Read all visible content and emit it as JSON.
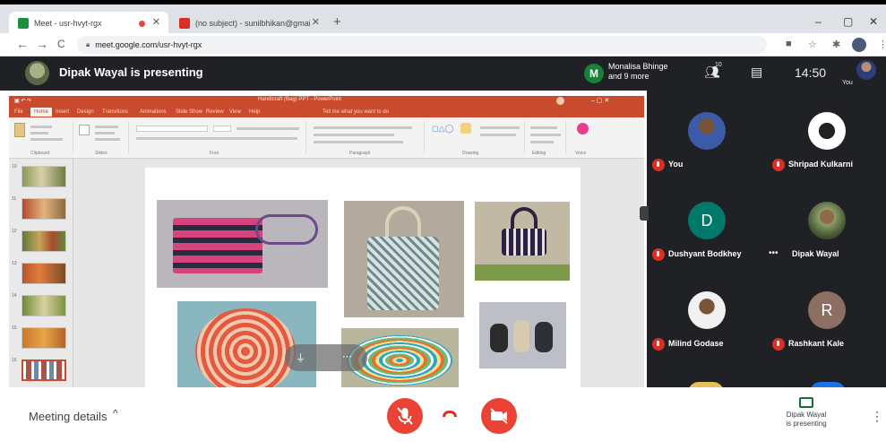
{
  "browser": {
    "tabs": [
      {
        "title": "Meet - usr-hvyt-rgx",
        "favicon_color": "#1e8e3e",
        "recording": true
      },
      {
        "title": "(no subject) - sunilbhikan@gmail.com",
        "favicon_color": "#d93025"
      }
    ],
    "new_tab_glyph": "+",
    "window_controls": {
      "minimize": "–",
      "maximize": "▢",
      "close": "✕"
    },
    "url": "meet.google.com/usr-hvyt-rgx",
    "nav": {
      "back": "←",
      "forward": "→",
      "reload": "C"
    },
    "toolbar_icons": [
      "camera-off-icon",
      "star-icon",
      "puzzle-icon",
      "profile-avatar",
      "kebab-icon"
    ]
  },
  "meet_header": {
    "presenter_text": "Dipak Wayal is presenting",
    "others_avatar_letter": "M",
    "others_text_line1": "Monalisa Bhinge",
    "others_text_line2": "and 9 more",
    "people_count": "10",
    "time": "14:50",
    "you_label": "You"
  },
  "presentation": {
    "window_title": "Handicraft (Bag) PPT - PowerPoint",
    "menu": [
      "File",
      "Home",
      "Insert",
      "Design",
      "Transitions",
      "Animations",
      "Slide Show",
      "Review",
      "View",
      "Help",
      "Tell me what you want to do"
    ],
    "active_menu_index": 1,
    "ribbon_groups": [
      "Clipboard",
      "Slides",
      "Font",
      "Paragraph",
      "Drawing",
      "Editing",
      "Voice"
    ],
    "slide_numbers": [
      "10",
      "11",
      "12",
      "13",
      "14",
      "15",
      "16"
    ],
    "overlay_icons": [
      "mic-icon",
      "more-icon"
    ]
  },
  "participants": [
    {
      "name": "You",
      "avatar": "photo",
      "colors": [
        "#3b5ba8",
        "#7a5236"
      ]
    },
    {
      "name": "Shripad Kulkarni",
      "avatar": "photo",
      "colors": [
        "#ffffff",
        "#222222"
      ]
    },
    {
      "name": "Dushyant Bodkhey",
      "avatar": "letter",
      "letter": "D",
      "colors": [
        "#00796b"
      ]
    },
    {
      "name": "Dipak Wayal",
      "avatar": "photo",
      "colors": [
        "#8fa06a",
        "#3f4f2f"
      ]
    },
    {
      "name": "Milind Godase",
      "avatar": "photo",
      "colors": [
        "#f1f1f1",
        "#7b5438"
      ]
    },
    {
      "name": "Rashkant Kale",
      "avatar": "letter",
      "letter": "R",
      "colors": [
        "#8d6e63"
      ]
    }
  ],
  "bottom": {
    "meeting_details": "Meeting details",
    "caret": "^",
    "presenting_card_line1": "Dipak Wayal",
    "presenting_card_line2": "is presenting",
    "kebab": "⋮"
  },
  "colors": {
    "meet_dark": "#202124",
    "control_red": "#ea4335",
    "ppt_orange": "#c94a2c"
  }
}
